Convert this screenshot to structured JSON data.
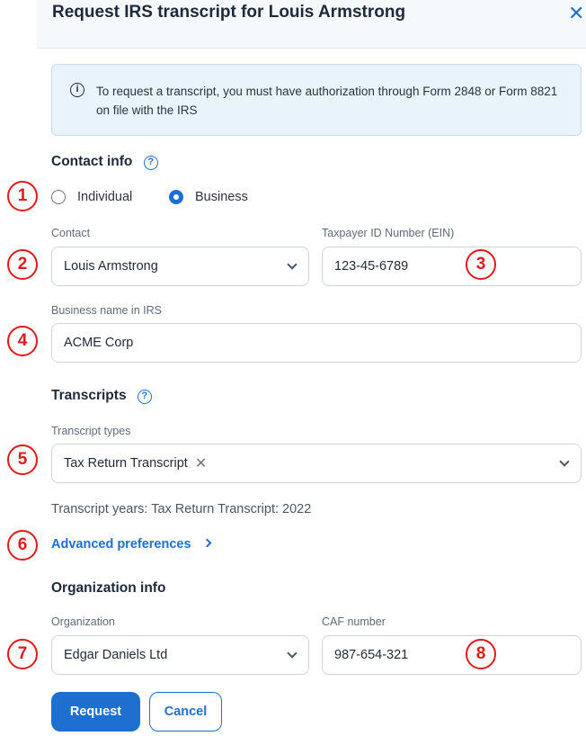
{
  "header": {
    "title": "Request IRS transcript for Louis Armstrong",
    "close_glyph": "✕"
  },
  "info": {
    "icon": "i",
    "text": "To request a transcript, you must have authorization through Form 2848 or Form 8821 on file with the IRS"
  },
  "contact": {
    "heading": "Contact info",
    "help_icon": "?",
    "radio_individual": "Individual",
    "radio_business": "Business",
    "selected": "Business",
    "contact_label": "Contact",
    "contact_value": "Louis Armstrong",
    "ein_label": "Taxpayer ID Number (EIN)",
    "ein_value": "123-45-6789",
    "business_label": "Business name in IRS",
    "business_value": "ACME Corp"
  },
  "transcripts": {
    "heading": "Transcripts",
    "help_icon": "?",
    "types_label": "Transcript types",
    "chip": "Tax Return Transcript",
    "chip_remove": "✕",
    "years_text": "Transcript years: Tax Return Transcript: 2022",
    "advanced_link": "Advanced preferences"
  },
  "organization": {
    "heading": "Organization info",
    "org_label": "Organization",
    "org_value": "Edgar Daniels Ltd",
    "caf_label": "CAF number",
    "caf_value": "987-654-321"
  },
  "actions": {
    "request": "Request",
    "cancel": "Cancel"
  },
  "markers": [
    "1",
    "2",
    "3",
    "4",
    "5",
    "6",
    "7",
    "8"
  ],
  "colors": {
    "accent": "#1e6fd0",
    "marker": "#e01b1b",
    "info_bg": "#e9f3fc"
  }
}
